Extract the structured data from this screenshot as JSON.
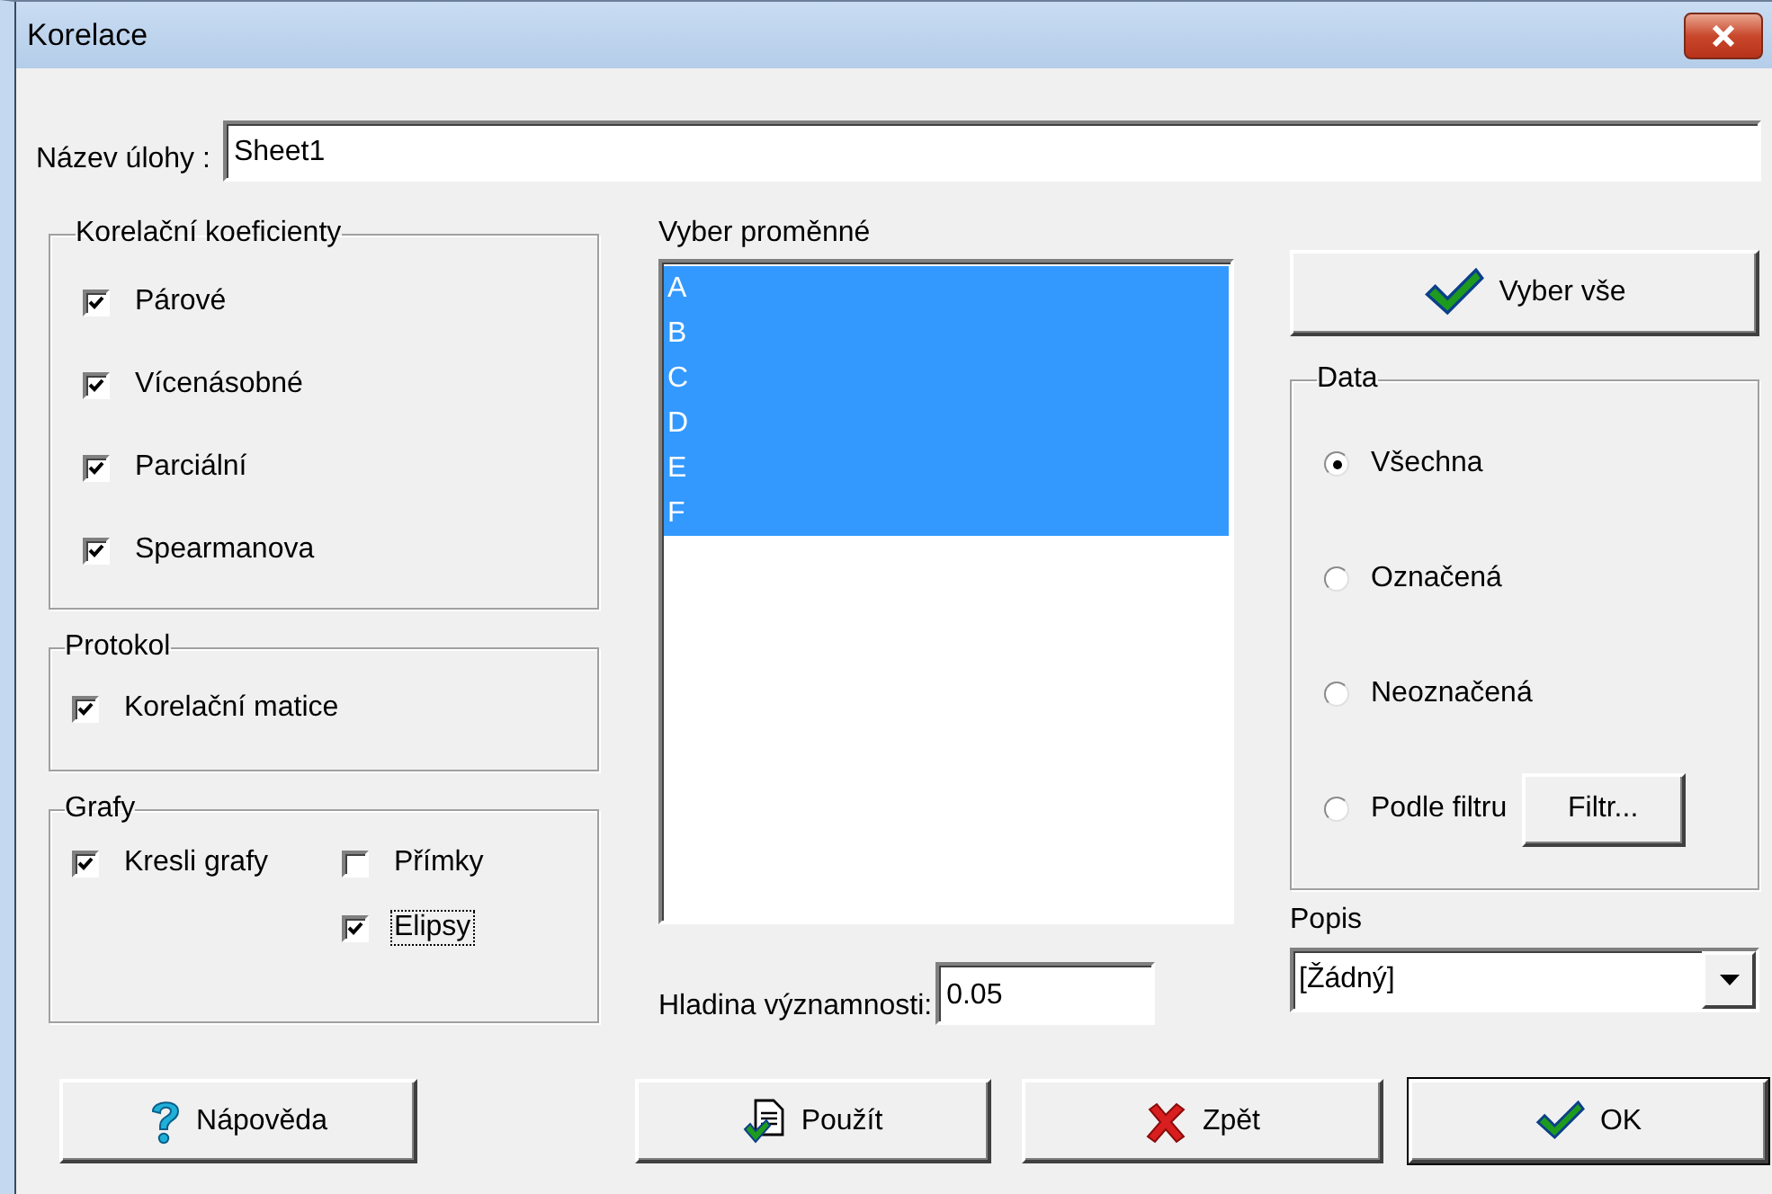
{
  "window": {
    "title": "Korelace"
  },
  "task_name": {
    "label": "Název úlohy :",
    "value": "Sheet1"
  },
  "coefficients": {
    "title": "Korelační koeficienty",
    "items": [
      {
        "label": "Párové",
        "checked": true
      },
      {
        "label": "Vícenásobné",
        "checked": true
      },
      {
        "label": "Parciální",
        "checked": true
      },
      {
        "label": "Spearmanova",
        "checked": true
      }
    ]
  },
  "protocol": {
    "title": "Protokol",
    "items": [
      {
        "label": "Korelační matice",
        "checked": true
      }
    ]
  },
  "graphs": {
    "title": "Grafy",
    "items": [
      {
        "label": "Kresli grafy",
        "checked": true,
        "focused": false
      },
      {
        "label": "Přímky",
        "checked": false,
        "focused": false
      },
      {
        "label": "Elipsy",
        "checked": true,
        "focused": true
      }
    ]
  },
  "variables": {
    "label": "Vyber proměnné",
    "items": [
      {
        "label": "A",
        "selected": true
      },
      {
        "label": "B",
        "selected": true
      },
      {
        "label": "C",
        "selected": true
      },
      {
        "label": "D",
        "selected": true
      },
      {
        "label": "E",
        "selected": true
      },
      {
        "label": "F",
        "selected": true
      }
    ]
  },
  "significance": {
    "label": "Hladina významnosti:",
    "value": "0.05"
  },
  "select_all_button": "Vyber vše",
  "data": {
    "title": "Data",
    "options": [
      {
        "label": "Všechna",
        "selected": true
      },
      {
        "label": "Označená",
        "selected": false
      },
      {
        "label": "Neoznačená",
        "selected": false
      },
      {
        "label": "Podle filtru",
        "selected": false
      }
    ],
    "filter_button": "Filtr..."
  },
  "description": {
    "label": "Popis",
    "value": "[Žádný]"
  },
  "buttons": [
    {
      "label": "Nápověda",
      "kind": "help"
    },
    {
      "label": "Použít",
      "kind": "apply"
    },
    {
      "label": "Zpět",
      "kind": "back"
    },
    {
      "label": "OK",
      "kind": "ok"
    }
  ]
}
